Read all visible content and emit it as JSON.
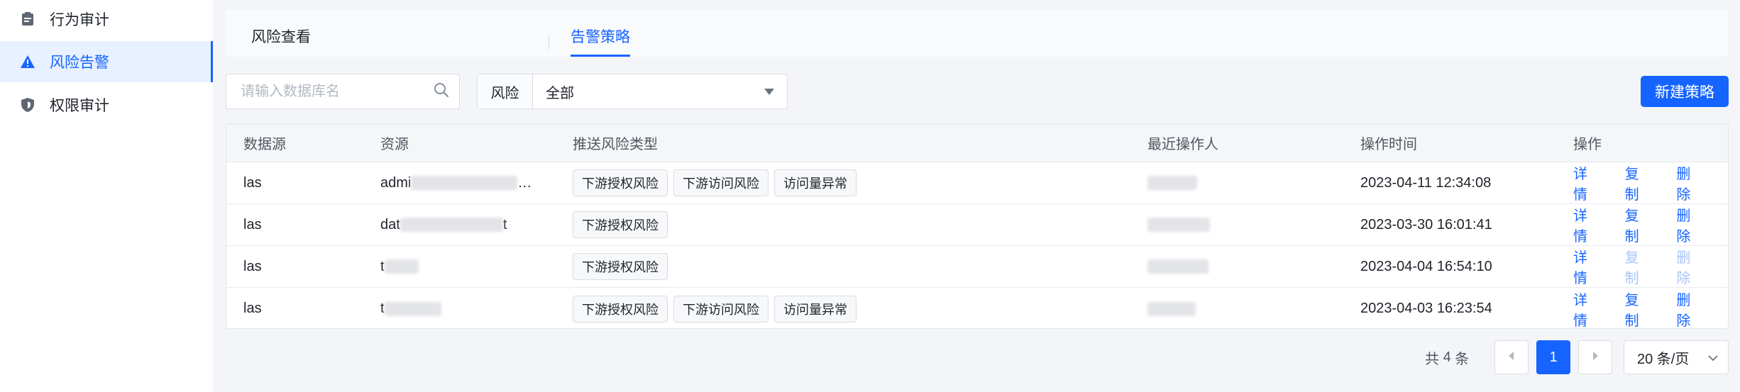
{
  "sidebar": {
    "items": [
      {
        "label": "行为审计",
        "icon": "clipboard-icon"
      },
      {
        "label": "风险告警",
        "icon": "warning-icon"
      },
      {
        "label": "权限审计",
        "icon": "shield-icon"
      }
    ]
  },
  "tabs": [
    {
      "label": "风险查看"
    },
    {
      "label": "告警策略"
    }
  ],
  "search": {
    "placeholder": "请输入数据库名",
    "value": ""
  },
  "filter": {
    "label": "风险",
    "value": "全部"
  },
  "new_button": "新建策略",
  "table": {
    "columns": [
      "数据源",
      "资源",
      "推送风险类型",
      "最近操作人",
      "操作时间",
      "操作"
    ],
    "rows": [
      {
        "source": "las",
        "resource_visible": "admi",
        "resource_suffix": "…",
        "types": [
          "下游授权风险",
          "下游访问风险",
          "访问量异常"
        ],
        "time": "2023-04-11 12:34:08",
        "ops": [
          "详情",
          "复制",
          "删除"
        ],
        "ops_disabled": [
          false,
          false,
          false
        ]
      },
      {
        "source": "las",
        "resource_visible": "dat",
        "resource_suffix": "t",
        "types": [
          "下游授权风险"
        ],
        "time": "2023-03-30 16:01:41",
        "ops": [
          "详情",
          "复制",
          "删除"
        ],
        "ops_disabled": [
          false,
          false,
          false
        ]
      },
      {
        "source": "las",
        "resource_visible": "t",
        "resource_suffix": "",
        "types": [
          "下游授权风险"
        ],
        "time": "2023-04-04 16:54:10",
        "ops": [
          "详情",
          "复制",
          "删除"
        ],
        "ops_disabled": [
          false,
          true,
          true
        ]
      },
      {
        "source": "las",
        "resource_visible": "t",
        "resource_suffix": "",
        "types": [
          "下游授权风险",
          "下游访问风险",
          "访问量异常"
        ],
        "time": "2023-04-03 16:23:54",
        "ops": [
          "详情",
          "复制",
          "删除"
        ],
        "ops_disabled": [
          false,
          false,
          false
        ]
      }
    ]
  },
  "pagination": {
    "total_prefix": "共",
    "total": "4",
    "total_suffix": "条",
    "current": "1",
    "page_size": "20 条/页"
  },
  "colors": {
    "accent": "#1664ff"
  }
}
